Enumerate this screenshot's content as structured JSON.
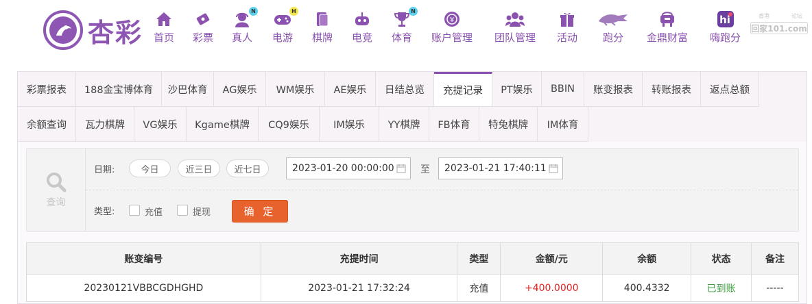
{
  "brand": {
    "name": "杏彩"
  },
  "nav": [
    {
      "label": "首页",
      "icon": "home-icon"
    },
    {
      "label": "彩票",
      "icon": "lottery-icon"
    },
    {
      "label": "真人",
      "icon": "live-dealer-icon",
      "badge": "N"
    },
    {
      "label": "电游",
      "icon": "gamepad-icon",
      "badge": "H"
    },
    {
      "label": "棋牌",
      "icon": "cards-icon"
    },
    {
      "label": "电竞",
      "icon": "esports-icon"
    },
    {
      "label": "体育",
      "icon": "trophy-icon",
      "badge": "N"
    },
    {
      "label": "账户管理",
      "icon": "account-icon"
    },
    {
      "label": "团队管理",
      "icon": "team-icon"
    },
    {
      "label": "活动",
      "icon": "gift-icon"
    },
    {
      "label": "跑分",
      "icon": "running-icon"
    },
    {
      "label": "金鼎财富",
      "icon": "wealth-icon"
    },
    {
      "label": "嗨跑分",
      "icon": "hi-icon"
    }
  ],
  "watermark": {
    "top_left": "香港",
    "top_right": "论坛",
    "main": "回家101.com"
  },
  "tabs_row1": [
    "彩票报表",
    "188金宝博体育",
    "沙巴体育",
    "AG娱乐",
    "WM娱乐",
    "AE娱乐",
    "日结总览",
    "充提记录",
    "PT娱乐",
    "BBIN",
    "账变报表",
    "转账报表",
    "返点总额"
  ],
  "tabs_row2": [
    "余额查询",
    "瓦力棋牌",
    "VG娱乐",
    "Kgame棋牌",
    "CQ9娱乐",
    "IM娱乐",
    "YY棋牌",
    "FB体育",
    "特兔棋牌",
    "IM体育"
  ],
  "active_tab": "充提记录",
  "filter": {
    "search_label": "查询",
    "date_label": "日期:",
    "quick_dates": [
      "今日",
      "近三日",
      "近七日"
    ],
    "start": "2023-01-20 00:00:00",
    "to": "至",
    "end": "2023-01-21 17:40:11",
    "type_label": "类型:",
    "types": [
      "充值",
      "提现"
    ],
    "confirm": "确 定"
  },
  "table": {
    "headers": [
      "账变编号",
      "充提时间",
      "类型",
      "金额/元",
      "余额",
      "状态",
      "备注"
    ],
    "rows": [
      [
        "20230121VBBCGDHGHD",
        "2023-01-21 17:32:24",
        "充值",
        "+400.0000",
        "400.4332",
        "已到账",
        "-----"
      ]
    ]
  },
  "colors": {
    "brand": "#8b52b0",
    "confirm": "#e8622d",
    "amount": "#e02222",
    "status_ok": "#3fa03f"
  }
}
